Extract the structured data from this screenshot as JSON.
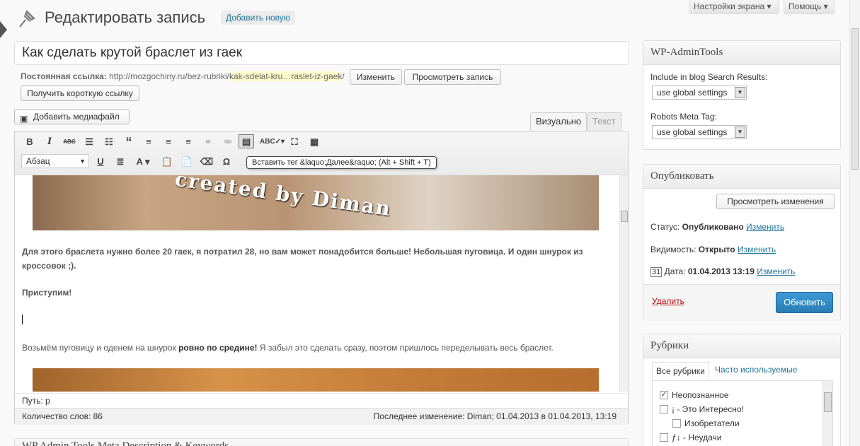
{
  "header": {
    "title": "Редактировать запись",
    "add_new": "Добавить новую",
    "screen_options": "Настройки экрана ▾",
    "help": "Помощь ▾"
  },
  "post": {
    "title": "Как сделать крутой браслет из гаек",
    "permalink_label": "Постоянная ссылка:",
    "permalink_base": "http://mozgochiny.ru/bez-rubriki/",
    "permalink_slug": "kak-sdelat-kru…raslet-iz-gaek",
    "permalink_end": "/",
    "change_button": "Изменить",
    "view_button": "Просмотреть запись",
    "shortlink_button": "Получить короткую ссылку"
  },
  "editor": {
    "add_media": "Добавить медиафайл",
    "tab_visual": "Визуально",
    "tab_text": "Текст",
    "format_select": "Абзац",
    "tooltip": "Вставить тег &laquo;Далее&raquo; (Alt + Shift + T)",
    "watermark": "created by Diman",
    "para1": "Для этого браслета нужно более 20 гаек, я потратил 28, но вам может понадобится больше! Небольшая пуговица. И один шнурок из кроссовок ;).",
    "para2": "Приступим!",
    "para3_start": "Возьмём пуговицу и оденем на шнурок ",
    "para3_bold": "ровно по средине!",
    "para3_end": " Я забыл это сделать сразу, поэтом пришлось переделывать весь браслет.",
    "path": "Путь: p",
    "word_count": "Количество слов: 86",
    "last_edit": "Последнее изменение: Diman; 01.04.2013 в 01.04.2013, 13:19"
  },
  "next_box_title": "WP Admin Tools Meta Description & Keywords",
  "admintools": {
    "title": "WP-AdminTools",
    "search_label": "Include in blog Search Results:",
    "search_value": "use global settings",
    "robots_label": "Robots Meta Tag:",
    "robots_value": "use global settings"
  },
  "publish": {
    "title": "Опубликовать",
    "preview_button": "Просмотреть изменения",
    "status_label": "Статус:",
    "status_value": "Опубликовано",
    "visibility_label": "Видимость:",
    "visibility_value": "Открыто",
    "date_label": "Дата:",
    "date_value": "01.04.2013 13:19",
    "change_link": "Изменить",
    "delete_link": "Удалить",
    "update_button": "Обновить"
  },
  "categories": {
    "title": "Рубрики",
    "tab_all": "Все рубрики",
    "tab_popular": "Часто используемые",
    "items": [
      "Неопознанное",
      "¡ - Это Интересно!",
      "Изобретатели",
      "ƒ↓ - Неудачи"
    ]
  },
  "colors": {
    "accent": "#21759b",
    "update_button": "#2e8ac4",
    "delete": "#bc0b0b"
  }
}
